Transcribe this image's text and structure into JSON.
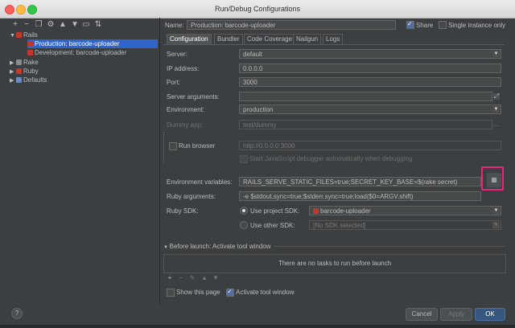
{
  "window": {
    "title": "Run/Debug Configurations"
  },
  "toolbar": {
    "icons": [
      "add-icon",
      "remove-icon",
      "copy-icon",
      "wrench-icon",
      "move-up-icon",
      "move-down-icon",
      "folder-icon",
      "sort-icon"
    ]
  },
  "tree": {
    "items": [
      {
        "label": "Rails",
        "expanded": true
      },
      {
        "label": "Production: barcode-uploader",
        "selected": true
      },
      {
        "label": "Development: barcode-uploader"
      },
      {
        "label": "Rake"
      },
      {
        "label": "Ruby"
      },
      {
        "label": "Defaults"
      }
    ]
  },
  "header": {
    "name_label": "Name:",
    "name_value": "Production: barcode-uploader",
    "share_label": "Share",
    "share_checked": true,
    "single_instance_label": "Single instance only",
    "single_instance_checked": false
  },
  "tabs": [
    "Configuration",
    "Bundler",
    "Code Coverage",
    "Nailgun",
    "Logs"
  ],
  "form": {
    "server_label": "Server:",
    "server_value": "default",
    "ip_label": "IP address:",
    "ip_value": "0.0.0.0",
    "port_label": "Port:",
    "port_value": "3000",
    "server_args_label": "Server arguments:",
    "server_args_value": "",
    "environment_label": "Environment:",
    "environment_value": "production",
    "dummy_app_label": "Dummy app:",
    "dummy_app_value": "test/dummy",
    "run_browser_label": "Run browser",
    "run_browser_value": "http://0.0.0.0:3000",
    "js_debugger_label": "Start JavaScript debugger automatically when debugging",
    "env_vars_label": "Environment variables:",
    "env_vars_value": "RAILS_SERVE_STATIC_FILES=true;SECRET_KEY_BASE=$(rake secret)",
    "ruby_args_label": "Ruby arguments:",
    "ruby_args_value": "-e $stdout.sync=true;$stderr.sync=true;load($0=ARGV.shift)",
    "ruby_sdk_label": "Ruby SDK:",
    "use_project_sdk_label": "Use project SDK:",
    "project_sdk_value": "barcode-uploader",
    "use_other_sdk_label": "Use other SDK:",
    "other_sdk_value": "[No SDK selected]"
  },
  "before_launch": {
    "title": "Before launch: Activate tool window",
    "empty_text": "There are no tasks to run before launch"
  },
  "footer": {
    "show_page_label": "Show this page",
    "activate_tool_label": "Activate tool window",
    "activate_checked": true,
    "cancel": "Cancel",
    "apply": "Apply",
    "ok": "OK",
    "help": "?"
  },
  "colors": {
    "selection": "#2f65ca",
    "highlight": "#e4297b",
    "primary_button": "#365880"
  }
}
